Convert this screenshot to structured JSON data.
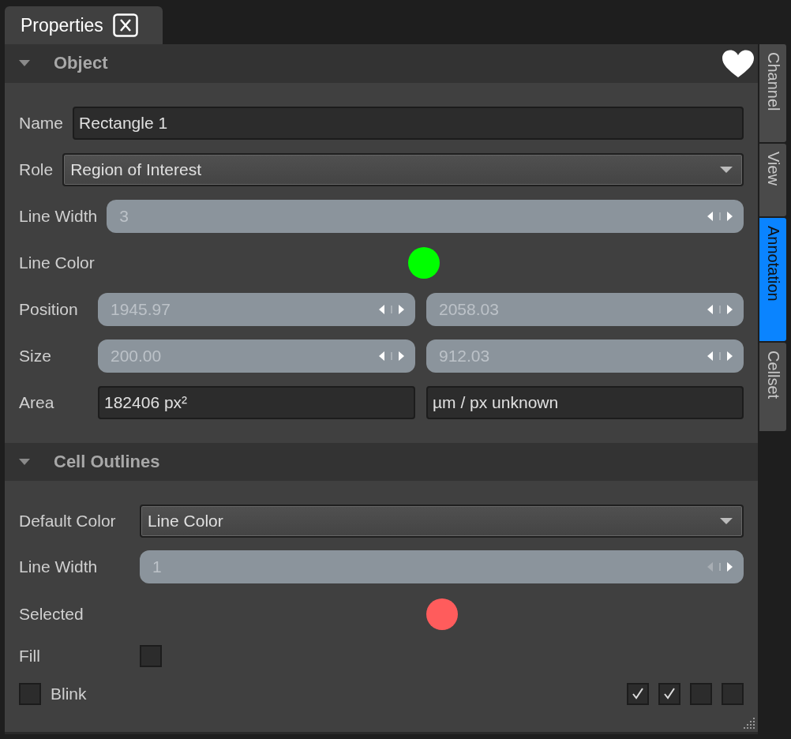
{
  "panel_tab": {
    "label": "Properties"
  },
  "sections": [
    {
      "title": "Object",
      "expanded": true,
      "favorite": true,
      "rows": [
        {
          "kind": "text",
          "label": "Name",
          "value": "Rectangle 1"
        },
        {
          "kind": "dropdown",
          "label": "Role",
          "value": "Region of Interest"
        },
        {
          "kind": "spinner",
          "label": "Line Width",
          "value": "3",
          "decrement_disabled": false
        },
        {
          "kind": "color",
          "label": "Line Color",
          "color": "#00ff00"
        },
        {
          "kind": "spinner_pair",
          "label": "Position",
          "values": [
            "1945.97",
            "2058.03"
          ]
        },
        {
          "kind": "spinner_pair",
          "label": "Size",
          "values": [
            "200.00",
            "912.03"
          ]
        },
        {
          "kind": "text_pair",
          "label": "Area",
          "values": [
            "182406 px²",
            "µm / px unknown"
          ]
        }
      ]
    },
    {
      "title": "Cell Outlines",
      "expanded": true,
      "rows": [
        {
          "kind": "dropdown",
          "label": "Default Color",
          "value": "Line Color"
        },
        {
          "kind": "spinner",
          "label": "Line Width",
          "value": "1",
          "decrement_disabled": true
        },
        {
          "kind": "color",
          "label": "Selected",
          "color": "#ff5c5c"
        },
        {
          "kind": "checkbox",
          "label": "Fill",
          "checked": false
        },
        {
          "kind": "check_group",
          "label": "Blink",
          "checked": false,
          "options": [
            {
              "checked": true
            },
            {
              "checked": true
            },
            {
              "checked": false
            },
            {
              "checked": false
            }
          ]
        }
      ]
    }
  ],
  "side_tabs": [
    {
      "label": "Channel",
      "selected": false
    },
    {
      "label": "View",
      "selected": false
    },
    {
      "label": "Annotation",
      "selected": true
    },
    {
      "label": "Cellset",
      "selected": false
    }
  ]
}
